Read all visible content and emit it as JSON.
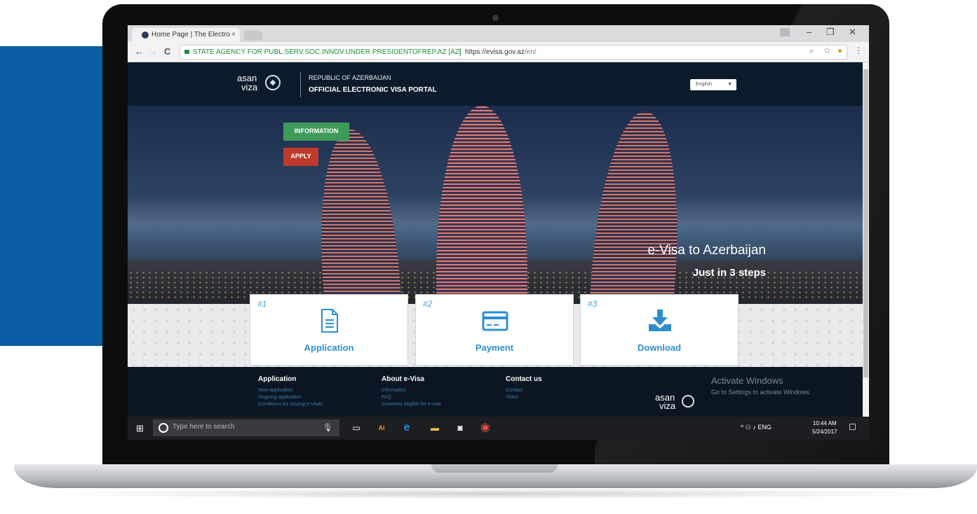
{
  "browser": {
    "tab_title": "Home Page | The Electro",
    "tab_close": "×",
    "window_controls": [
      "–",
      "❐",
      "✕"
    ],
    "cert_name": "STATE AGENCY FOR PUBL.SERV.SOC.INNOV.UNDER PRESIDENTOFREP.AZ [AZ]",
    "url_host": "https://evisa.gov.az",
    "url_path": "/en/",
    "nav": {
      "back": "←",
      "forward": "→",
      "reload": "C"
    },
    "toolbar_icons": [
      "search-icon",
      "star-icon",
      "extension-icon",
      "menu-icon"
    ]
  },
  "site": {
    "logo_text_top": "asan",
    "logo_text_bottom": "viza",
    "header_top": "REPUBLIC OF AZERBAIJAN",
    "header_main": "OFFICIAL ELECTRONIC VISA PORTAL",
    "language": "English"
  },
  "hero": {
    "info_button": "INFORMATION",
    "apply_button": "APPLY",
    "title": "e-Visa to Azerbaijan",
    "subtitle": "Just in 3 steps"
  },
  "steps": [
    {
      "num": "#1",
      "label": "Application",
      "icon": "document-icon"
    },
    {
      "num": "#2",
      "label": "Payment",
      "icon": "credit-card-icon"
    },
    {
      "num": "#3",
      "label": "Download",
      "icon": "download-icon"
    }
  ],
  "footer": {
    "columns": [
      {
        "title": "Application",
        "links": [
          "New application",
          "Ongoing application",
          "Conditions for issuing e-Visas"
        ]
      },
      {
        "title": "About e-Visa",
        "links": [
          "Information",
          "FAQ",
          "Countries eligible for e-visa"
        ]
      },
      {
        "title": "Contact us",
        "links": [
          "Contact",
          "Video"
        ]
      }
    ],
    "logo_top": "asan",
    "logo_bottom": "viza"
  },
  "watermark": {
    "title": "Activate Windows",
    "subtitle": "Go to Settings to activate Windows."
  },
  "taskbar": {
    "search_placeholder": "Type here to search",
    "apps": [
      "task-view-icon",
      "illustrator-icon",
      "edge-icon",
      "file-explorer-icon",
      "store-icon",
      "chrome-icon"
    ],
    "lang": "ENG",
    "time": "10:44 AM",
    "date": "5/24/2017"
  },
  "colors": {
    "side_panel": "#0a5ea3",
    "info_button": "#3e9a5a",
    "apply_button": "#c0392b",
    "step_label": "#2d8fd0"
  }
}
